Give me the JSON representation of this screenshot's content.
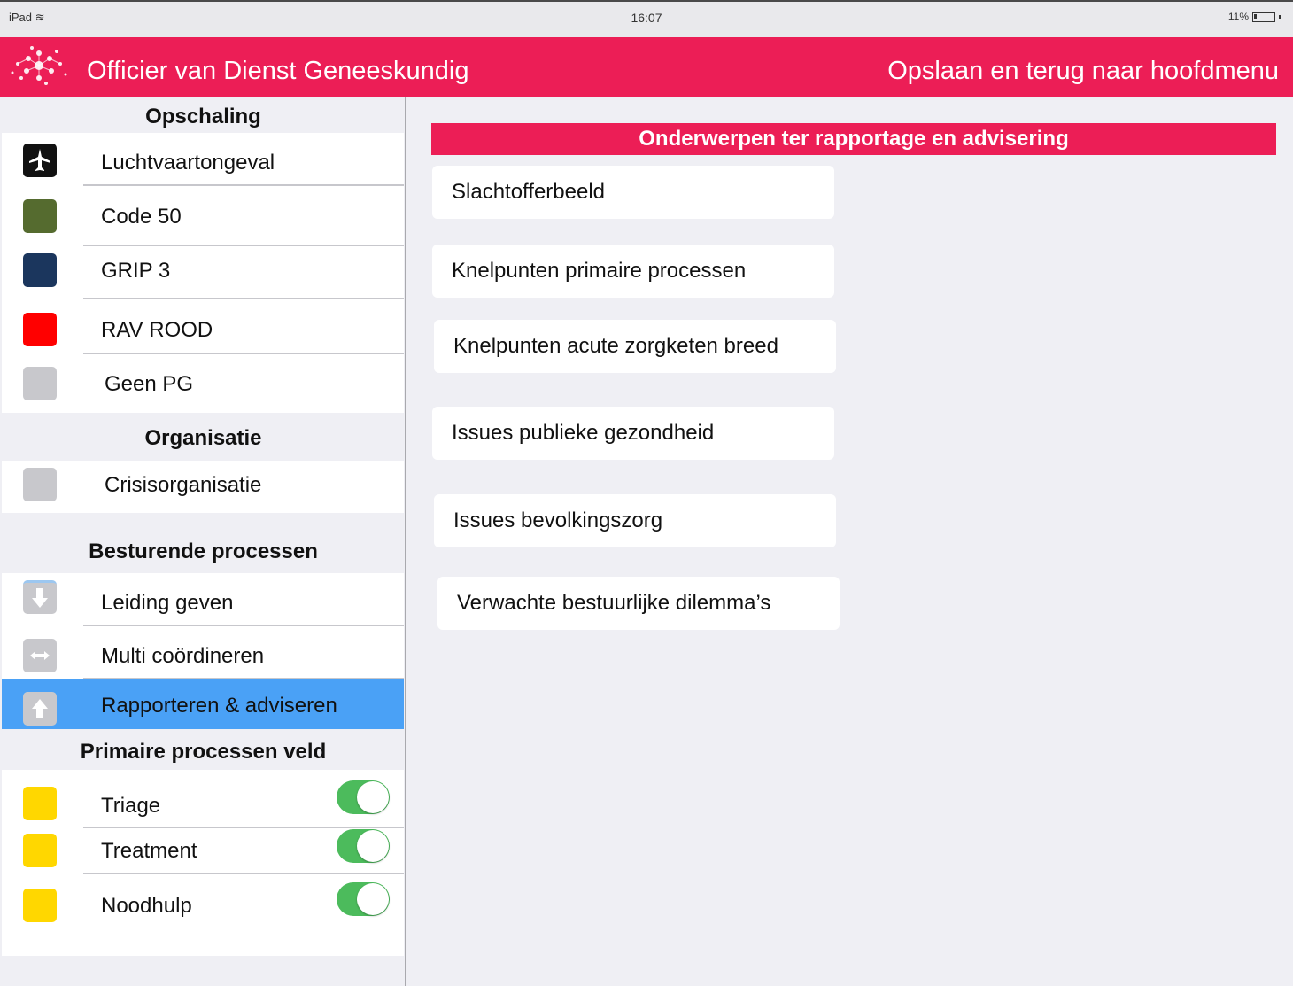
{
  "statusbar": {
    "device": "iPad",
    "time": "16:07",
    "battery": "11%"
  },
  "header": {
    "title": "Officier van Dienst Geneeskundig",
    "back_label": "Opslaan en terug naar hoofdmenu"
  },
  "sidebar": {
    "opschaling": {
      "heading": "Opschaling",
      "items": [
        {
          "label": "Luchtvaartongeval",
          "color": "#111111",
          "icon": "airplane-icon"
        },
        {
          "label": "Code 50",
          "color": "#556b2f"
        },
        {
          "label": "GRIP 3",
          "color": "#1b365d"
        },
        {
          "label": "RAV ROOD",
          "color": "#ff0000"
        },
        {
          "label": "Geen PG",
          "color": "#c8c8cc"
        }
      ]
    },
    "organisatie": {
      "heading": "Organisatie",
      "items": [
        {
          "label": "Crisisorganisatie",
          "color": "#c8c8cc"
        }
      ]
    },
    "besturend": {
      "heading": "Besturende processen",
      "items": [
        {
          "label": "Leiding geven",
          "color": "#c8c8cc",
          "icon": "arrow-down-icon"
        },
        {
          "label": "Multi coördineren",
          "color": "#c8c8cc",
          "icon": "arrows-horizontal-icon"
        },
        {
          "label": "Rapporteren & adviseren",
          "color": "#c8c8cc",
          "icon": "arrow-up-icon",
          "selected": true
        }
      ]
    },
    "primair": {
      "heading": "Primaire processen veld",
      "items": [
        {
          "label": "Triage",
          "color": "#ffd700",
          "toggle": true
        },
        {
          "label": "Treatment",
          "color": "#ffd700",
          "toggle": true
        },
        {
          "label": "Noodhulp",
          "color": "#ffd700",
          "toggle": true
        }
      ]
    }
  },
  "main": {
    "banner": "Onderwerpen ter rapportage en advisering",
    "topics": [
      "Slachtofferbeeld",
      "Knelpunten primaire processen",
      "Knelpunten acute zorgketen breed",
      "Issues publieke gezondheid",
      "Issues bevolkingszorg",
      "Verwachte bestuurlijke dilemma’s"
    ]
  },
  "colors": {
    "accent": "#ec1e56",
    "selected": "#4aa1f6",
    "toggle_on": "#4cbb5c"
  }
}
